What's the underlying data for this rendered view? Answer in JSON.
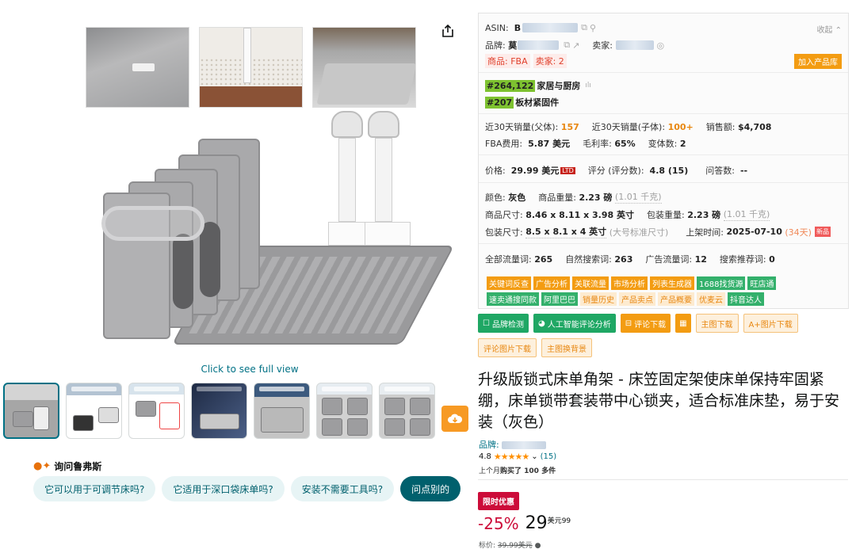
{
  "gallery": {
    "see_full": "Click to see full view",
    "thumb_count": 7
  },
  "ask": {
    "title": "询问鲁弗斯",
    "chips": [
      "它可以用于可调节床吗?",
      "它适用于深口袋床单吗?",
      "安装不需要工具吗?",
      "问点别的"
    ]
  },
  "panel": {
    "asin_label": "ASIN:",
    "asin_value": "B",
    "collect": "收起",
    "brand_label": "品牌:",
    "brand_value": "莫",
    "seller_label": "卖家:",
    "product_fba": "商品: FBA",
    "seller_count": "卖家: 2",
    "add_library": "加入产品库",
    "rank1_num": "#264,122",
    "rank1_cat_a": "家居",
    "rank1_cat_b": "与厨房",
    "rank2_num": "#207",
    "rank2_cat_a": "板材",
    "rank2_cat_b": "紧固件",
    "sales_parent_label": "近30天销量(父体):",
    "sales_parent": "157",
    "sales_child_label": "近30天销量(子体):",
    "sales_child": "100+",
    "revenue_label": "销售额:",
    "revenue": "$4,708",
    "fba_label": "FBA费用:",
    "fba": "5.87 美元",
    "margin_label": "毛利率:",
    "margin": "65%",
    "variants_label": "变体数:",
    "variants": "2",
    "price_label": "价格:",
    "price": "29.99 美元",
    "ltd": "LTD",
    "rating_label": "评分 (评分数):",
    "rating": "4.8  (15)",
    "qa_label": "问答数:",
    "qa": "--",
    "color_label": "颜色:",
    "color": "灰色",
    "weight_label": "商品重量:",
    "weight": "2.23 磅",
    "weight_kg": "(1.01 千克)",
    "size_label": "商品尺寸:",
    "size": "8.46 x 8.11 x 3.98 英寸",
    "pkg_weight_label": "包装重量:",
    "pkg_weight": "2.23 磅",
    "pkg_weight_kg": "(1.01 千克)",
    "pkg_size_label": "包装尺寸:",
    "pkg_size": "8.5 x 8.1 x 4 英寸",
    "pkg_size_class": "(大号标准尺寸)",
    "listed_label": "上架时间:",
    "listed": "2025-07-10",
    "listed_days": "(34天)",
    "new_tag": "新品",
    "all_kw_label": "全部流量词:",
    "all_kw": "265",
    "natural_kw_label": "自然搜索词:",
    "natural_kw": "263",
    "ad_kw_label": "广告流量词:",
    "ad_kw": "12",
    "rec_kw_label": "搜索推荐词:",
    "rec_kw": "0",
    "tags_row1": [
      "关键词反查",
      "广告分析",
      "关联流量",
      "市场分析",
      "列表生成器",
      "1688找货源",
      "旺店通"
    ],
    "tags_row2": [
      "速卖通搜同款",
      "阿里巴巴"
    ],
    "tags_row2_light": [
      "销量历史",
      "产品卖点",
      "产品概要",
      "优麦云",
      "抖音达人"
    ]
  },
  "tools": {
    "brand_check": "品牌检测",
    "ai_review": "人工智能评论分析",
    "review_download": "评论下载",
    "main_image_dl": "主图下载",
    "aplus_dl": "A+图片下载",
    "review_img_dl": "评论图片下载",
    "main_bg_swap": "主图换背景"
  },
  "product": {
    "title": "升级版锁式床单角架 - 床笠固定架使床单保持牢固紧绷，床单锁带套装带中心锁夹，适合标准床垫，易于安装（灰色）",
    "brand_label": "品牌:",
    "rating_value": "4.8",
    "rating_count": "(15)",
    "bought_prefix": "上个月",
    "bought_strong": "购买了 100 多件",
    "deal_badge": "限时优惠",
    "discount": "-25%",
    "price_whole": "29",
    "price_currency": "美元",
    "price_fraction": "99",
    "list_label": "标价:",
    "list_price": "39.99美元"
  },
  "colors": {
    "accent_teal": "#007185",
    "deal_red": "#cc0c39",
    "star_orange": "#ff8f00",
    "tool_green": "#1fa764",
    "tool_orange": "#f39c12"
  }
}
